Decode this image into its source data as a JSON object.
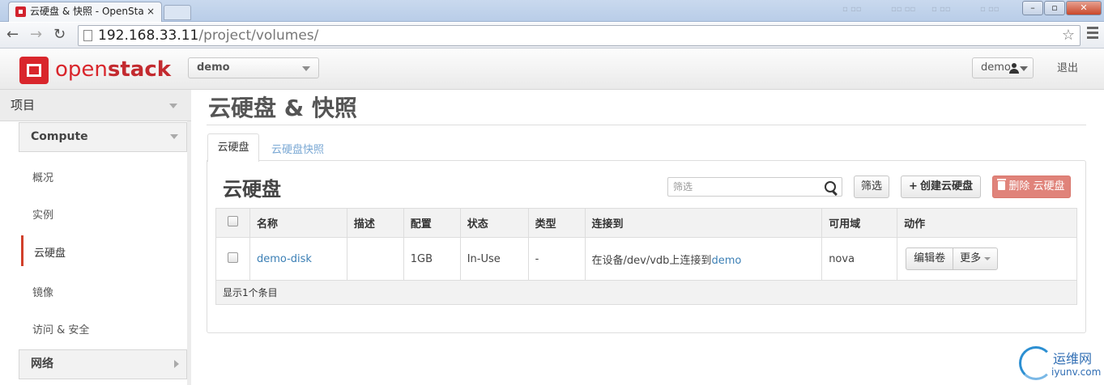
{
  "browser": {
    "tab_title": "云硬盘 & 快照 - OpenSta",
    "tab_close": "×",
    "address_host": "192.168.33.11",
    "address_path": "/project/volumes/"
  },
  "header": {
    "logo_prefix": "open",
    "logo_suffix": "stack",
    "project_select": "demo",
    "user_menu": "demo",
    "logout": "退出"
  },
  "sidebar": {
    "project": "项目",
    "compute_group": "Compute",
    "items": [
      "概况",
      "实例",
      "云硬盘",
      "镜像",
      "访问 & 安全"
    ],
    "active_index": 2,
    "network_group": "网络"
  },
  "main": {
    "page_title": "云硬盘 & 快照",
    "tabs": [
      "云硬盘",
      "云硬盘快照"
    ],
    "table_title": "云硬盘",
    "filter_placeholder": "筛选",
    "filter_button": "筛选",
    "create_button": "创建云硬盘",
    "delete_button": "删除 云硬盘",
    "columns": [
      "名称",
      "描述",
      "配置",
      "状态",
      "类型",
      "连接到",
      "可用域",
      "动作"
    ],
    "rows": [
      {
        "name": "demo-disk",
        "description": "",
        "size": "1GB",
        "status": "In-Use",
        "type": "-",
        "attached_prefix": "在设备/dev/vdb上连接到",
        "attached_instance": "demo",
        "zone": "nova",
        "action_edit": "编辑卷",
        "action_more": "更多"
      }
    ],
    "footer": "显示1个条目"
  },
  "watermark": {
    "cn": "运维网",
    "en": "iyunv.com"
  }
}
